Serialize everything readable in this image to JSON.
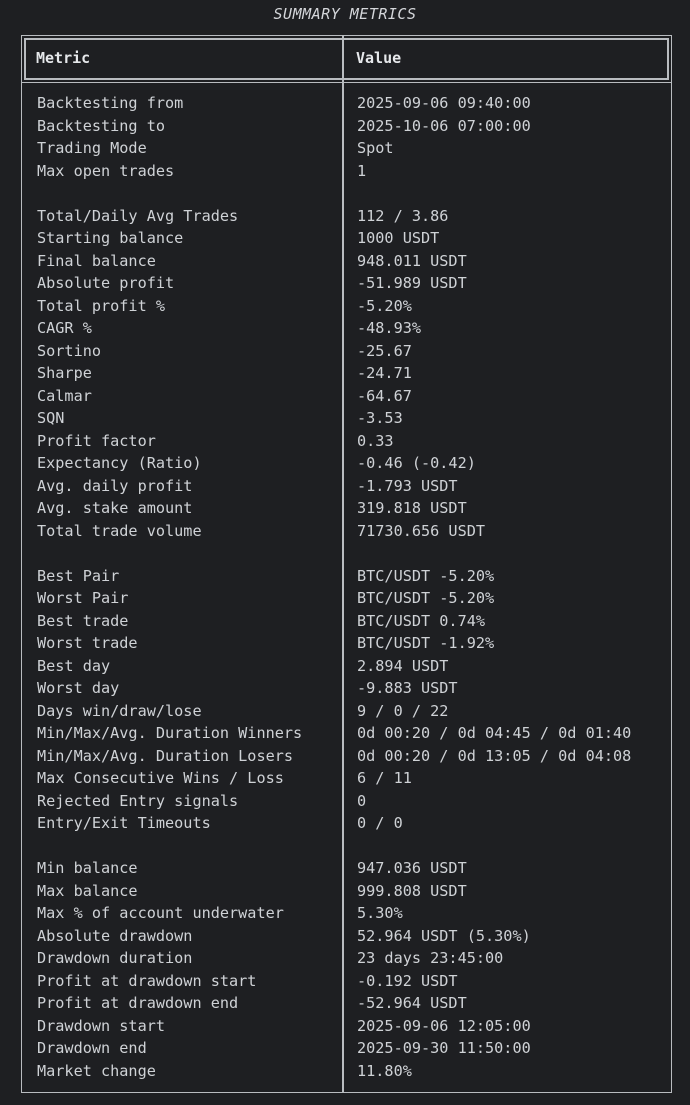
{
  "title": "SUMMARY METRICS",
  "table": {
    "headers": {
      "metric": "Metric",
      "value": "Value"
    },
    "rows": [
      {
        "metric": "Backtesting from",
        "value": "2025-09-06 09:40:00"
      },
      {
        "metric": "Backtesting to",
        "value": "2025-10-06 07:00:00"
      },
      {
        "metric": "Trading Mode",
        "value": "Spot"
      },
      {
        "metric": "Max open trades",
        "value": "1"
      },
      {
        "metric": "",
        "value": ""
      },
      {
        "metric": "Total/Daily Avg Trades",
        "value": "112 / 3.86"
      },
      {
        "metric": "Starting balance",
        "value": "1000 USDT"
      },
      {
        "metric": "Final balance",
        "value": "948.011 USDT"
      },
      {
        "metric": "Absolute profit",
        "value": "-51.989 USDT"
      },
      {
        "metric": "Total profit %",
        "value": "-5.20%"
      },
      {
        "metric": "CAGR %",
        "value": "-48.93%"
      },
      {
        "metric": "Sortino",
        "value": "-25.67"
      },
      {
        "metric": "Sharpe",
        "value": "-24.71"
      },
      {
        "metric": "Calmar",
        "value": "-64.67"
      },
      {
        "metric": "SQN",
        "value": "-3.53"
      },
      {
        "metric": "Profit factor",
        "value": "0.33"
      },
      {
        "metric": "Expectancy (Ratio)",
        "value": "-0.46 (-0.42)"
      },
      {
        "metric": "Avg. daily profit",
        "value": "-1.793 USDT"
      },
      {
        "metric": "Avg. stake amount",
        "value": "319.818 USDT"
      },
      {
        "metric": "Total trade volume",
        "value": "71730.656 USDT"
      },
      {
        "metric": "",
        "value": ""
      },
      {
        "metric": "Best Pair",
        "value": "BTC/USDT -5.20%"
      },
      {
        "metric": "Worst Pair",
        "value": "BTC/USDT -5.20%"
      },
      {
        "metric": "Best trade",
        "value": "BTC/USDT 0.74%"
      },
      {
        "metric": "Worst trade",
        "value": "BTC/USDT -1.92%"
      },
      {
        "metric": "Best day",
        "value": "2.894 USDT"
      },
      {
        "metric": "Worst day",
        "value": "-9.883 USDT"
      },
      {
        "metric": "Days win/draw/lose",
        "value": "9 / 0 / 22"
      },
      {
        "metric": "Min/Max/Avg. Duration Winners",
        "value": "0d 00:20 / 0d 04:45 / 0d 01:40"
      },
      {
        "metric": "Min/Max/Avg. Duration Losers",
        "value": "0d 00:20 / 0d 13:05 / 0d 04:08"
      },
      {
        "metric": "Max Consecutive Wins / Loss",
        "value": "6 / 11"
      },
      {
        "metric": "Rejected Entry signals",
        "value": "0"
      },
      {
        "metric": "Entry/Exit Timeouts",
        "value": "0 / 0"
      },
      {
        "metric": "",
        "value": ""
      },
      {
        "metric": "Min balance",
        "value": "947.036 USDT"
      },
      {
        "metric": "Max balance",
        "value": "999.808 USDT"
      },
      {
        "metric": "Max % of account underwater",
        "value": "5.30%"
      },
      {
        "metric": "Absolute drawdown",
        "value": "52.964 USDT (5.30%)"
      },
      {
        "metric": "Drawdown duration",
        "value": "23 days 23:45:00"
      },
      {
        "metric": "Profit at drawdown start",
        "value": "-0.192 USDT"
      },
      {
        "metric": "Profit at drawdown end",
        "value": "-52.964 USDT"
      },
      {
        "metric": "Drawdown start",
        "value": "2025-09-06 12:05:00"
      },
      {
        "metric": "Drawdown end",
        "value": "2025-09-30 11:50:00"
      },
      {
        "metric": "Market change",
        "value": "11.80%"
      }
    ]
  }
}
